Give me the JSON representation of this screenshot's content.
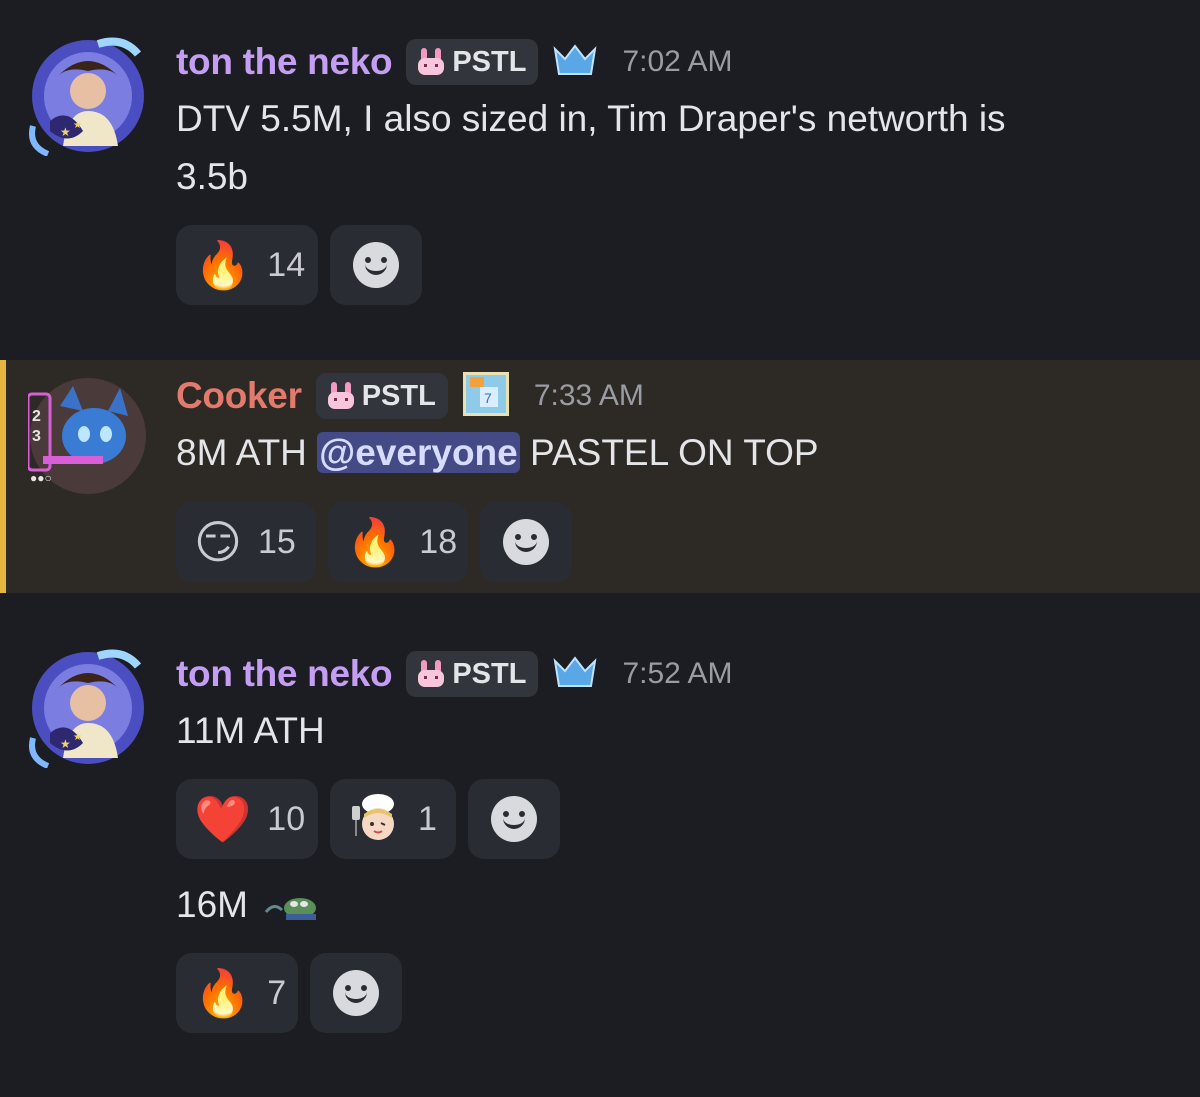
{
  "messages": [
    {
      "username": "ton the neko",
      "tag": "PSTL",
      "time": "7:02 AM",
      "text_lines": [
        "DTV 5.5M, I also sized in, Tim Draper's networth is",
        "3.5b"
      ],
      "reactions": [
        {
          "emoji": "fire",
          "glyph": "🔥",
          "count": "14"
        }
      ]
    },
    {
      "username": "Cooker",
      "tag": "PSTL",
      "time": "7:33 AM",
      "text_before": "8M ATH ",
      "mention": "@everyone",
      "text_after": " PASTEL ON TOP",
      "reactions": [
        {
          "emoji": "smirk",
          "glyph": "😏",
          "count": "15"
        },
        {
          "emoji": "fire",
          "glyph": "🔥",
          "count": "18"
        }
      ]
    },
    {
      "username": "ton the neko",
      "tag": "PSTL",
      "time": "7:52 AM",
      "text": "11M ATH",
      "reactions": [
        {
          "emoji": "heart",
          "glyph": "❤️",
          "count": "10"
        },
        {
          "emoji": "chef-custom-emoji",
          "count": "1"
        }
      ]
    },
    {
      "text": "16M",
      "inline_emoji": "pepe-swim-custom-emoji",
      "reactions": [
        {
          "emoji": "fire",
          "glyph": "🔥",
          "count": "7"
        }
      ]
    }
  ],
  "colors": {
    "background": "#1c1d22",
    "highlight_bg": "#2d2a25",
    "highlight_bar": "#e6b63e",
    "neko_name": "#c49ef2",
    "cooker_name": "#e27a6e",
    "mention_bg": "#434a86"
  }
}
